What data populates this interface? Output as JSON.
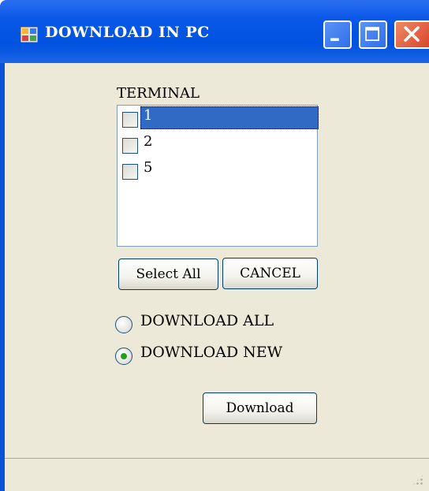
{
  "window": {
    "title": "DOWNLOAD IN PC",
    "controls": [
      "minimize",
      "maximize",
      "close"
    ]
  },
  "terminal": {
    "label": "TERMINAL",
    "items": [
      {
        "label": "1",
        "checked": false,
        "selected": true
      },
      {
        "label": "2",
        "checked": false,
        "selected": false
      },
      {
        "label": "5",
        "checked": false,
        "selected": false
      }
    ]
  },
  "buttons": {
    "select_all": "Select All",
    "cancel": "CANCEL",
    "download": "Download"
  },
  "options": {
    "download_all": {
      "label": "DOWNLOAD ALL",
      "selected": false
    },
    "download_new": {
      "label": "DOWNLOAD NEW",
      "selected": true
    }
  },
  "colors": {
    "titlebar": "#0052df",
    "client_bg": "#ece9d8",
    "selection": "#316ac5",
    "radio_dot": "#21a121",
    "close_button": "#d8462a"
  },
  "icons": {
    "app": "app-window-icon",
    "minimize": "minimize-icon",
    "maximize": "maximize-icon",
    "close": "close-icon"
  }
}
